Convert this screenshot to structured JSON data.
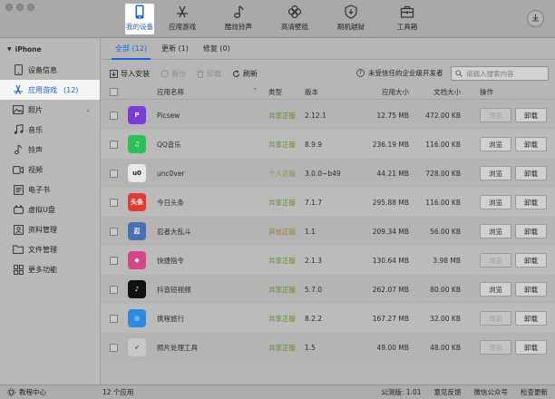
{
  "toolbar": {
    "tabs": [
      {
        "label": "我的设备",
        "icon": "phone-icon"
      },
      {
        "label": "应用游戏",
        "icon": "appstore-icon"
      },
      {
        "label": "酷炫铃声",
        "icon": "music-note-icon"
      },
      {
        "label": "高清壁纸",
        "icon": "flower-icon"
      },
      {
        "label": "刷机越狱",
        "icon": "shield-icon"
      },
      {
        "label": "工具箱",
        "icon": "toolbox-icon"
      }
    ],
    "active_tab": 0,
    "download_icon": "download-icon"
  },
  "sidebar": {
    "device": "iPhone",
    "items": [
      {
        "label": "设备信息",
        "icon": "device-info-icon"
      },
      {
        "label": "应用游戏",
        "icon": "appstore-icon",
        "count": "(12)"
      },
      {
        "label": "照片",
        "icon": "photo-icon"
      },
      {
        "label": "音乐",
        "icon": "music-icon"
      },
      {
        "label": "铃声",
        "icon": "bell-icon"
      },
      {
        "label": "视频",
        "icon": "video-icon"
      },
      {
        "label": "电子书",
        "icon": "ebook-icon"
      },
      {
        "label": "虚拟U盘",
        "icon": "usb-icon"
      },
      {
        "label": "资料管理",
        "icon": "contacts-icon"
      },
      {
        "label": "文件管理",
        "icon": "folder-icon"
      },
      {
        "label": "更多功能",
        "icon": "grid-icon"
      }
    ],
    "active_item": 1
  },
  "subtabs": [
    {
      "label": "全部 (12)"
    },
    {
      "label": "更新 (1)"
    },
    {
      "label": "修复 (0)"
    }
  ],
  "actions": {
    "install": "导入安装",
    "backup": "备份",
    "uninstall": "卸载",
    "refresh": "刷新",
    "untrusted": "未受信任的企业级开发者"
  },
  "search": {
    "placeholder": "请输入搜索内容"
  },
  "table": {
    "headers": {
      "name": "应用名称",
      "type": "类型",
      "version": "版本",
      "app_size": "应用大小",
      "doc_size": "文档大小",
      "op": "操作"
    },
    "browse_label": "浏览",
    "uninstall_label": "卸载",
    "rows": [
      {
        "name": "Picsew",
        "type": "共享正版",
        "version": "2.12.1",
        "app_size": "12.75 MB",
        "doc_size": "472.00 KB",
        "icon_color": "#7a3bd6",
        "icon_glyph": "P",
        "browse_enabled": false
      },
      {
        "name": "QQ音乐",
        "type": "共享正版",
        "version": "8.9.9",
        "app_size": "236.19 MB",
        "doc_size": "116.00 KB",
        "icon_color": "#2fbf5a",
        "icon_glyph": "♫",
        "browse_enabled": true
      },
      {
        "name": "unc0ver",
        "type": "个人正版",
        "version": "3.0.0~b49",
        "app_size": "44.21 MB",
        "doc_size": "728.00 KB",
        "icon_color": "#e8e8e8",
        "icon_glyph": "u0",
        "browse_enabled": true
      },
      {
        "name": "今日头条",
        "type": "共享正版",
        "version": "7.1.7",
        "app_size": "295.88 MB",
        "doc_size": "116.00 KB",
        "icon_color": "#e53935",
        "icon_glyph": "头条",
        "browse_enabled": true
      },
      {
        "name": "忍者大乱斗",
        "type": "其他正版",
        "version": "1.1",
        "app_size": "209.34 MB",
        "doc_size": "56.00 KB",
        "icon_color": "#4a6fb5",
        "icon_glyph": "忍",
        "browse_enabled": true
      },
      {
        "name": "快捷指令",
        "type": "共享正版",
        "version": "2.1.3",
        "app_size": "130.64 MB",
        "doc_size": "3.98 MB",
        "icon_color": "#d6458a",
        "icon_glyph": "◆",
        "browse_enabled": false
      },
      {
        "name": "抖音短视频",
        "type": "共享正版",
        "version": "5.7.0",
        "app_size": "262.07 MB",
        "doc_size": "80.00 KB",
        "icon_color": "#111111",
        "icon_glyph": "♪",
        "browse_enabled": true
      },
      {
        "name": "携程旅行",
        "type": "共享正版",
        "version": "8.2.2",
        "app_size": "167.27 MB",
        "doc_size": "32.00 KB",
        "icon_color": "#2d8ae0",
        "icon_glyph": "◎",
        "browse_enabled": false
      },
      {
        "name": "照片处理工具",
        "type": "共享正版",
        "version": "1.5",
        "app_size": "49.00 MB",
        "doc_size": "48.00 KB",
        "icon_color": "#c8c8c8",
        "icon_glyph": "➶",
        "browse_enabled": false
      }
    ]
  },
  "status": {
    "tutorial": "教程中心",
    "app_count": "12 个应用",
    "version": "公测版: 1.01",
    "feedback": "意见反馈",
    "wechat": "微信公众号",
    "update": "检查更新"
  }
}
